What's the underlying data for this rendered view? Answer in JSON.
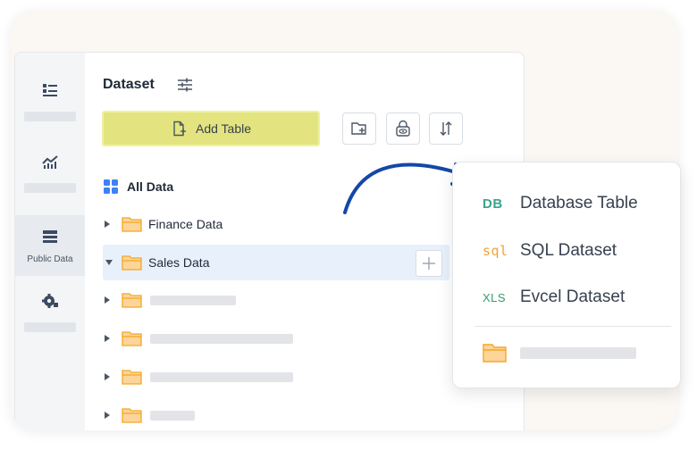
{
  "sidebar": {
    "items": [
      {
        "icon": "list-icon",
        "label": ""
      },
      {
        "icon": "line-chart-icon",
        "label": ""
      },
      {
        "icon": "database-icon",
        "label": "Public Data",
        "active": true
      },
      {
        "icon": "gear-icon",
        "label": ""
      }
    ]
  },
  "panel": {
    "title": "Dataset",
    "add_table_label": "Add Table",
    "all_data_label": "All Data",
    "tree": [
      {
        "label": "Finance Data",
        "expanded": false
      },
      {
        "label": "Sales Data",
        "expanded": true,
        "selected": true
      }
    ]
  },
  "popover": {
    "items": [
      {
        "code": "DB",
        "label": "Database Table",
        "color": "#3aa48c"
      },
      {
        "code": "sql",
        "label": "SQL Dataset",
        "color": "#f0a23a"
      },
      {
        "code": "XLS",
        "label": "Evcel Dataset",
        "color": "#3a9a6a"
      }
    ]
  },
  "colors": {
    "accent_yellow": "#e3e47f",
    "selection_blue": "#e8f0fc",
    "arrow_blue": "#1447a8",
    "folder_orange": "#f5a623"
  }
}
